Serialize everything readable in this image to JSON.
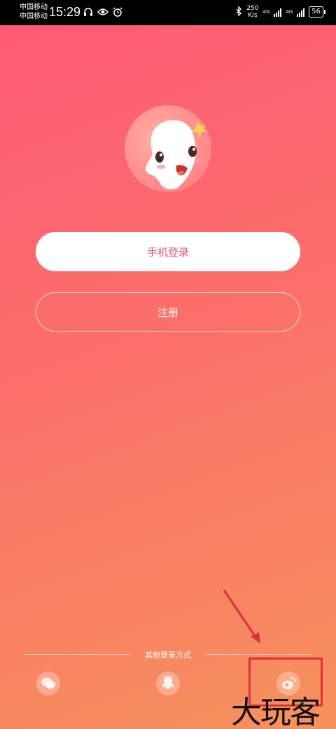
{
  "status_bar": {
    "carrier_1": "中国移动",
    "carrier_2": "中国移动",
    "time": "15:29",
    "net_speed_value": "250",
    "net_speed_unit": "K/s",
    "network_type_1": "4G",
    "network_type_2": "4G",
    "battery": "56",
    "icons": [
      "headphones-icon",
      "eye-icon",
      "alarm-icon",
      "bluetooth-icon",
      "signal-icon"
    ]
  },
  "login": {
    "phone_login_label": "手机登录",
    "register_label": "注册"
  },
  "other_login": {
    "label": "其他登录方式",
    "options": [
      "wechat-icon",
      "qq-icon",
      "weibo-icon"
    ]
  },
  "watermark": "大玩客",
  "colors": {
    "gradient_top": "#ff5a77",
    "gradient_bottom": "#f6925c",
    "button_text": "#e35b73",
    "annotation": "#e0303a"
  }
}
